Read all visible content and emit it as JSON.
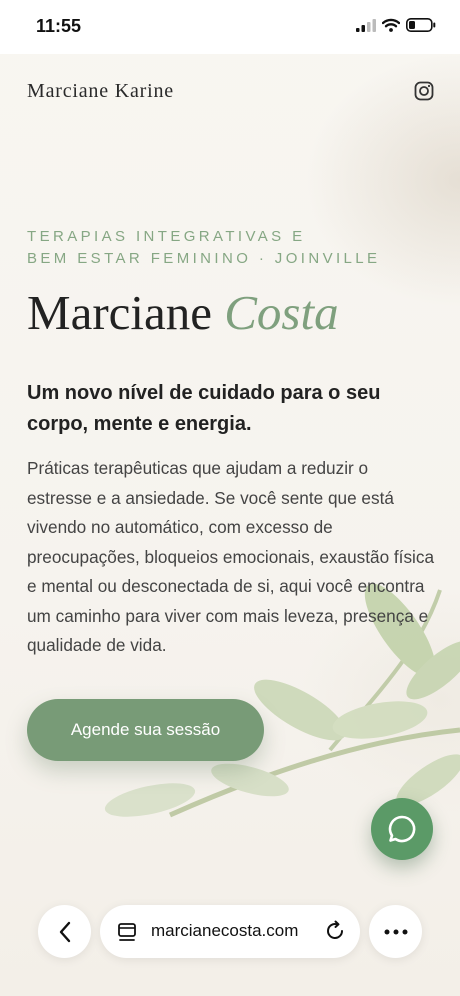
{
  "status_bar": {
    "time": "11:55"
  },
  "header": {
    "brand": "Marciane Karine",
    "social_icon": "instagram-icon"
  },
  "hero": {
    "eyebrow_line1": "TERAPIAS INTEGRATIVAS E",
    "eyebrow_line2": "BEM ESTAR FEMININO · JOINVILLE",
    "title_first": "Marciane",
    "title_accent": "Costa",
    "subtitle": "Um novo nível de cuidado para o seu corpo, mente e energia.",
    "body": "Práticas terapêuticas que ajudam a reduzir o estresse e a ansiedade. Se você sente que está vivendo no automático, com excesso de preocupações, bloqueios emocionais, exaustão física e mental ou desconectada de si, aqui você encontra um caminho para viver com mais leveza, presença e qualidade de vida.",
    "cta_label": "Agende sua sessão"
  },
  "floating": {
    "icon": "whatsapp-chat-icon"
  },
  "browser": {
    "url": "marcianecosta.com",
    "back_icon": "chevron-left-icon",
    "tabs_icon": "tabs-icon",
    "reload_icon": "reload-icon",
    "more_icon": "more-dots-icon"
  },
  "colors": {
    "accent_green": "#789b77",
    "eyebrow_green": "#86a784",
    "whatsapp_green": "#5b9a67",
    "background": "#f7f4ef"
  }
}
